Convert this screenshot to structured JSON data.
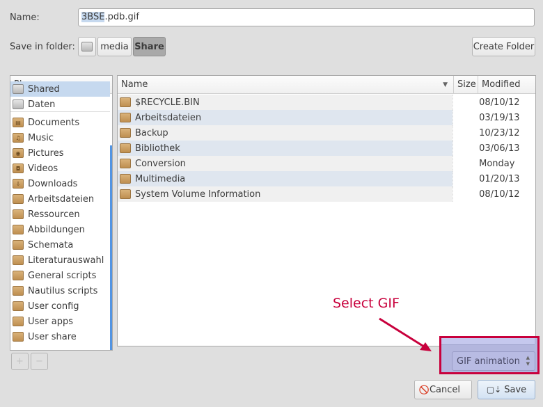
{
  "name_label": "Name:",
  "name_value": "3BSE.pdb.gif",
  "name_selected": "3BSE",
  "name_rest": ".pdb.gif",
  "folder_label": "Save in folder:",
  "path": [
    "media",
    "Share"
  ],
  "create_folder": "Create Folder",
  "places": {
    "header": "Places",
    "items": [
      {
        "label": "Shared",
        "icon": "drive-icon"
      },
      {
        "label": "Daten",
        "icon": "drive-icon"
      },
      {
        "label": "Documents",
        "icon": "folder-documents-icon"
      },
      {
        "label": "Music",
        "icon": "folder-music-icon"
      },
      {
        "label": "Pictures",
        "icon": "folder-pictures-icon"
      },
      {
        "label": "Videos",
        "icon": "folder-videos-icon"
      },
      {
        "label": "Downloads",
        "icon": "folder-downloads-icon"
      },
      {
        "label": "Arbeitsdateien",
        "icon": "folder-icon"
      },
      {
        "label": "Ressourcen",
        "icon": "folder-icon"
      },
      {
        "label": "Abbildungen",
        "icon": "folder-icon"
      },
      {
        "label": "Schemata",
        "icon": "folder-icon"
      },
      {
        "label": "Literaturauswahl",
        "icon": "folder-icon"
      },
      {
        "label": "General scripts",
        "icon": "folder-icon"
      },
      {
        "label": "Nautilus scripts",
        "icon": "folder-icon"
      },
      {
        "label": "User config",
        "icon": "folder-icon"
      },
      {
        "label": "User apps",
        "icon": "folder-icon"
      },
      {
        "label": "User share",
        "icon": "folder-icon"
      }
    ]
  },
  "add_label": "+",
  "remove_label": "−",
  "files": {
    "columns": [
      "Name",
      "Size",
      "Modified"
    ],
    "rows": [
      {
        "name": "$RECYCLE.BIN",
        "size": "",
        "modified": "08/10/12"
      },
      {
        "name": "Arbeitsdateien",
        "size": "",
        "modified": "03/19/13"
      },
      {
        "name": "Backup",
        "size": "",
        "modified": "10/23/12"
      },
      {
        "name": "Bibliothek",
        "size": "",
        "modified": "03/06/13"
      },
      {
        "name": "Conversion",
        "size": "",
        "modified": "Monday"
      },
      {
        "name": "Multimedia",
        "size": "",
        "modified": "01/20/13"
      },
      {
        "name": "System Volume Information",
        "size": "",
        "modified": "08/10/12"
      }
    ]
  },
  "filter": "GIF animation",
  "annotation": {
    "text": "Select GIF",
    "color": "#c8003c"
  },
  "cancel": "Cancel",
  "save": "Save"
}
